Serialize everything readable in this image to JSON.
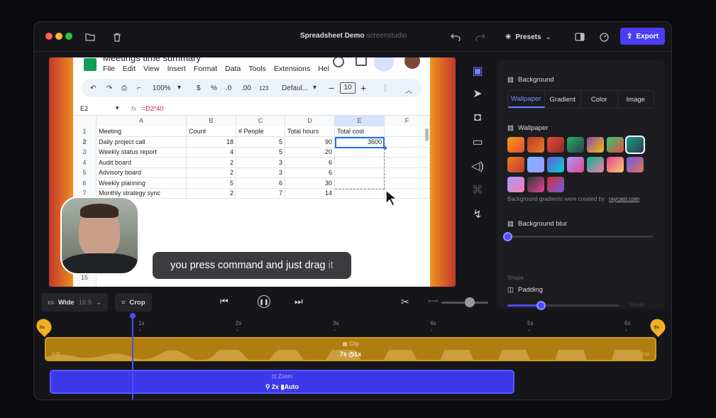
{
  "window": {
    "title": "Spreadsheet Demo",
    "title_sub": "screenstudio"
  },
  "header": {
    "presets_label": "Presets",
    "export_label": "Export"
  },
  "sheet": {
    "doc_title": "Meetings time summary",
    "menu": [
      "File",
      "Edit",
      "View",
      "Insert",
      "Format",
      "Data",
      "Tools",
      "Extensions",
      "Hel"
    ],
    "toolbar": {
      "zoom": "100%",
      "currency": "$",
      "percent": "%",
      "dec_less": ".0",
      "dec_more": ".00",
      "numfmt": "123",
      "font": "Defaul...",
      "font_size": "10"
    },
    "formula": {
      "cell_ref": "E2",
      "fx": "fx",
      "formula": "=D2*40"
    },
    "col_headers": [
      "A",
      "B",
      "C",
      "D",
      "E",
      "F"
    ],
    "row_numbers": [
      "1",
      "2",
      "3",
      "4",
      "5",
      "6",
      "7",
      "15"
    ],
    "headers": [
      "Meeting",
      "Count",
      "# People",
      "Total hours",
      "Total cost"
    ],
    "rows": [
      [
        "Daily project call",
        "18",
        "5",
        "90",
        "3600"
      ],
      [
        "Weekly status report",
        "4",
        "5",
        "20",
        ""
      ],
      [
        "Audit board",
        "2",
        "3",
        "6",
        ""
      ],
      [
        "Advisory board",
        "2",
        "3",
        "6",
        ""
      ],
      [
        "Weekly planning",
        "5",
        "6",
        "30",
        ""
      ],
      [
        "Monthly strategy sync",
        "2",
        "7",
        "14",
        ""
      ]
    ]
  },
  "caption": {
    "text": "you press command and just drag",
    "highlight": "it"
  },
  "panel": {
    "background_label": "Background",
    "tabs": [
      "Wallpaper",
      "Gradient",
      "Color",
      "Image"
    ],
    "active_tab": "Wallpaper",
    "wallpaper_label": "Wallpaper",
    "credit_prefix": "Background gradients were created by",
    "credit_link": "raycast.com",
    "blur_label": "Background blur",
    "blur_value": 0,
    "shape_label": "Shape",
    "padding_label": "Padding",
    "padding_value": 0.3,
    "reset_label": "Reset",
    "wallpaper_colors": [
      [
        "#f39c12",
        "#e74c3c"
      ],
      [
        "#c0392b",
        "#e67e22"
      ],
      [
        "#e74c3c",
        "#8e2a2a"
      ],
      [
        "#27ae60",
        "#2c3e50"
      ],
      [
        "#8e44ad",
        "#f1c40f"
      ],
      [
        "#2ecc71",
        "#e74c3c"
      ],
      [
        "#16a085",
        "#2c3e50"
      ],
      [
        "#e67e22",
        "#c0392b"
      ],
      [
        "#74b9ff",
        "#a29bfe"
      ],
      [
        "#6c5ce7",
        "#00cec9"
      ],
      [
        "#a29bfe",
        "#e84393"
      ],
      [
        "#00b894",
        "#fd79a8"
      ],
      [
        "#e84393",
        "#fdcb6e"
      ],
      [
        "#6c5ce7",
        "#e17055"
      ],
      [
        "#a29bfe",
        "#fd79a8"
      ],
      [
        "#2d3436",
        "#e84393"
      ],
      [
        "#d63031",
        "#6c5ce7"
      ]
    ]
  },
  "bottombar": {
    "aspect_label": "Wide",
    "aspect_ratio": "16:9",
    "crop_label": "Crop",
    "zoom_slider_value": 0.6
  },
  "timeline": {
    "ticks": [
      "1s",
      "2s",
      "3s",
      "4s",
      "5s",
      "6s"
    ],
    "start_marker": "0s",
    "end_marker": "6s",
    "clip_label": "Clip",
    "clip_duration": "7s",
    "clip_speed": "1x",
    "clip_start": "0:00",
    "clip_end": "0:12",
    "zoom_label": "Zoom",
    "zoom_level": "2x",
    "zoom_mode": "Auto"
  }
}
